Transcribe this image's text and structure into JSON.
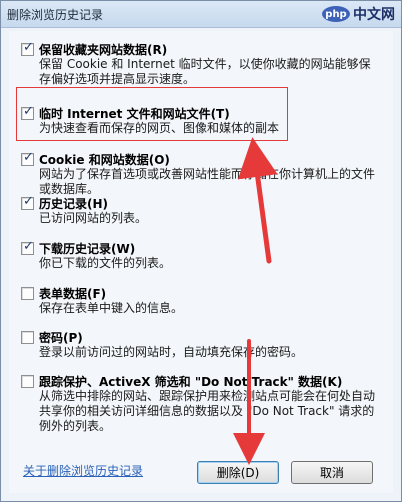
{
  "window": {
    "title": "删除浏览历史记录",
    "watermark": {
      "badge": "php",
      "text": "中文网"
    }
  },
  "options": [
    {
      "checked": true,
      "title": "保留收藏夹网站数据(R)",
      "desc": "保留 Cookie 和 Internet 临时文件，以使你收藏的网站能够保存偏好选项并提高显示速度。"
    },
    {
      "checked": true,
      "title": "临时 Internet 文件和网站文件(T)",
      "desc": "为快速查看而保存的网页、图像和媒体的副本"
    },
    {
      "checked": true,
      "title": "Cookie 和网站数据(O)",
      "desc": "网站为了保存首选项或改善网站性能而存储在你计算机上的文件或数据库。"
    },
    {
      "checked": true,
      "title": "历史记录(H)",
      "desc": "已访问网站的列表。"
    },
    {
      "checked": true,
      "title": "下载历史记录(W)",
      "desc": "你已下载的文件的列表。"
    },
    {
      "checked": false,
      "title": "表单数据(F)",
      "desc": "保存在表单中键入的信息。"
    },
    {
      "checked": false,
      "title": "密码(P)",
      "desc": "登录以前访问过的网站时，自动填充保存的密码。"
    },
    {
      "checked": false,
      "title": "跟踪保护、ActiveX 筛选和 \"Do Not Track\" 数据(K)",
      "desc": "从筛选中排除的网站、跟踪保护用来检测站点可能会在何处自动共享你的相关访问详细信息的数据以及 \"Do Not Track\" 请求的例外的列表。"
    }
  ],
  "footer": {
    "link": "关于删除浏览历史记录",
    "delete_button": "删除(D)",
    "cancel_button": "取消"
  },
  "colors": {
    "annotation": "#e63a3a",
    "link": "#2a62b8"
  }
}
